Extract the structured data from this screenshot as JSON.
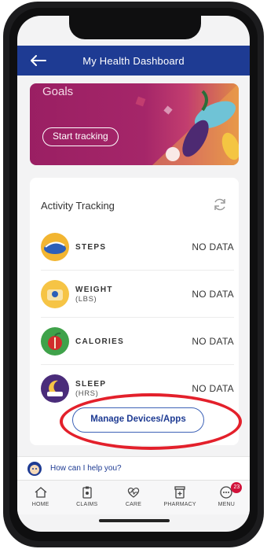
{
  "header": {
    "title": "My Health Dashboard"
  },
  "banner": {
    "heading": "Goals",
    "start_label": "Start tracking"
  },
  "activity": {
    "title": "Activity Tracking",
    "rows": [
      {
        "label": "STEPS",
        "sub": "",
        "value": "NO DATA",
        "icon": "steps-icon"
      },
      {
        "label": "WEIGHT",
        "sub": "(LBS)",
        "value": "NO DATA",
        "icon": "scale-icon"
      },
      {
        "label": "CALORIES",
        "sub": "",
        "value": "NO DATA",
        "icon": "apple-icon"
      },
      {
        "label": "SLEEP",
        "sub": "(HRS)",
        "value": "NO DATA",
        "icon": "moon-icon"
      }
    ],
    "manage_label": "Manage Devices/Apps"
  },
  "help": {
    "text": "How can I help you?"
  },
  "tabbar": {
    "items": [
      {
        "label": "HOME",
        "icon": "home-icon"
      },
      {
        "label": "CLAIMS",
        "icon": "clipboard-icon"
      },
      {
        "label": "CARE",
        "icon": "heartbeat-icon"
      },
      {
        "label": "PHARMACY",
        "icon": "pharmacy-icon"
      },
      {
        "label": "MENU",
        "icon": "menu-icon",
        "badge": "23"
      }
    ]
  },
  "colors": {
    "header": "#1e3b93",
    "accent": "#3d62b7",
    "highlight": "#e3202b",
    "badge": "#d1123a"
  }
}
